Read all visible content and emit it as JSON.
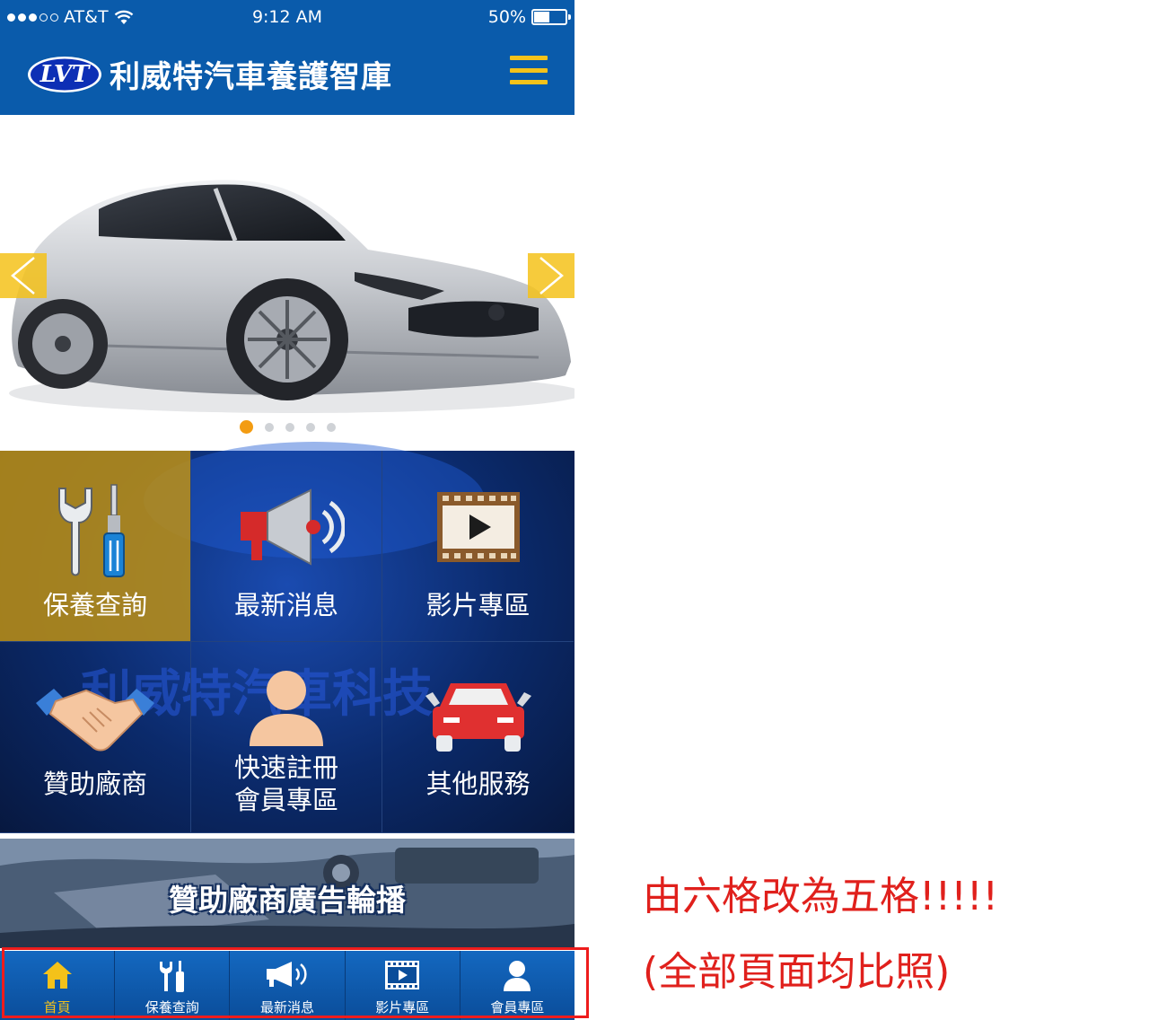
{
  "status_bar": {
    "carrier": "AT&T",
    "time": "9:12 AM",
    "battery": "50%"
  },
  "header": {
    "logo_text": "LVT",
    "title": "利威特汽車養護智庫",
    "menu_icon": "hamburger-menu-icon"
  },
  "carousel": {
    "image": "silver-sports-car-photo",
    "slide_count": 5,
    "active_slide": 1,
    "prev_icon": "chevron-left-icon",
    "next_icon": "chevron-right-icon"
  },
  "grid": {
    "watermark": "利威特汽車科技",
    "tiles": [
      {
        "label": "保養查詢",
        "icon": "wrench-screwdriver-icon",
        "active": true
      },
      {
        "label": "最新消息",
        "icon": "megaphone-icon",
        "active": false
      },
      {
        "label": "影片專區",
        "icon": "film-play-icon",
        "active": false
      },
      {
        "label": "贊助廠商",
        "icon": "handshake-icon",
        "active": false
      },
      {
        "label_line1": "快速註冊",
        "label_line2": "會員專區",
        "icon": "user-icon",
        "active": false
      },
      {
        "label": "其他服務",
        "icon": "car-icon",
        "active": false
      }
    ]
  },
  "ad_banner": {
    "label": "贊助廠商廣告輪播"
  },
  "tab_bar": {
    "tabs": [
      {
        "label": "首頁",
        "icon": "home-icon",
        "active": true
      },
      {
        "label": "保養查詢",
        "icon": "wrench-screwdriver-icon",
        "active": false
      },
      {
        "label": "最新消息",
        "icon": "megaphone-icon",
        "active": false
      },
      {
        "label": "影片專區",
        "icon": "film-play-icon",
        "active": false
      },
      {
        "label": "會員專區",
        "icon": "user-icon",
        "active": false
      }
    ]
  },
  "annotation": {
    "line1": "由六格改為五格!!!!!",
    "line2": "(全部頁面均比照)"
  },
  "colors": {
    "header_blue": "#0a5bab",
    "accent_yellow": "#f4c21a",
    "active_tile": "#be9114",
    "annotation_red": "#e0201c"
  }
}
